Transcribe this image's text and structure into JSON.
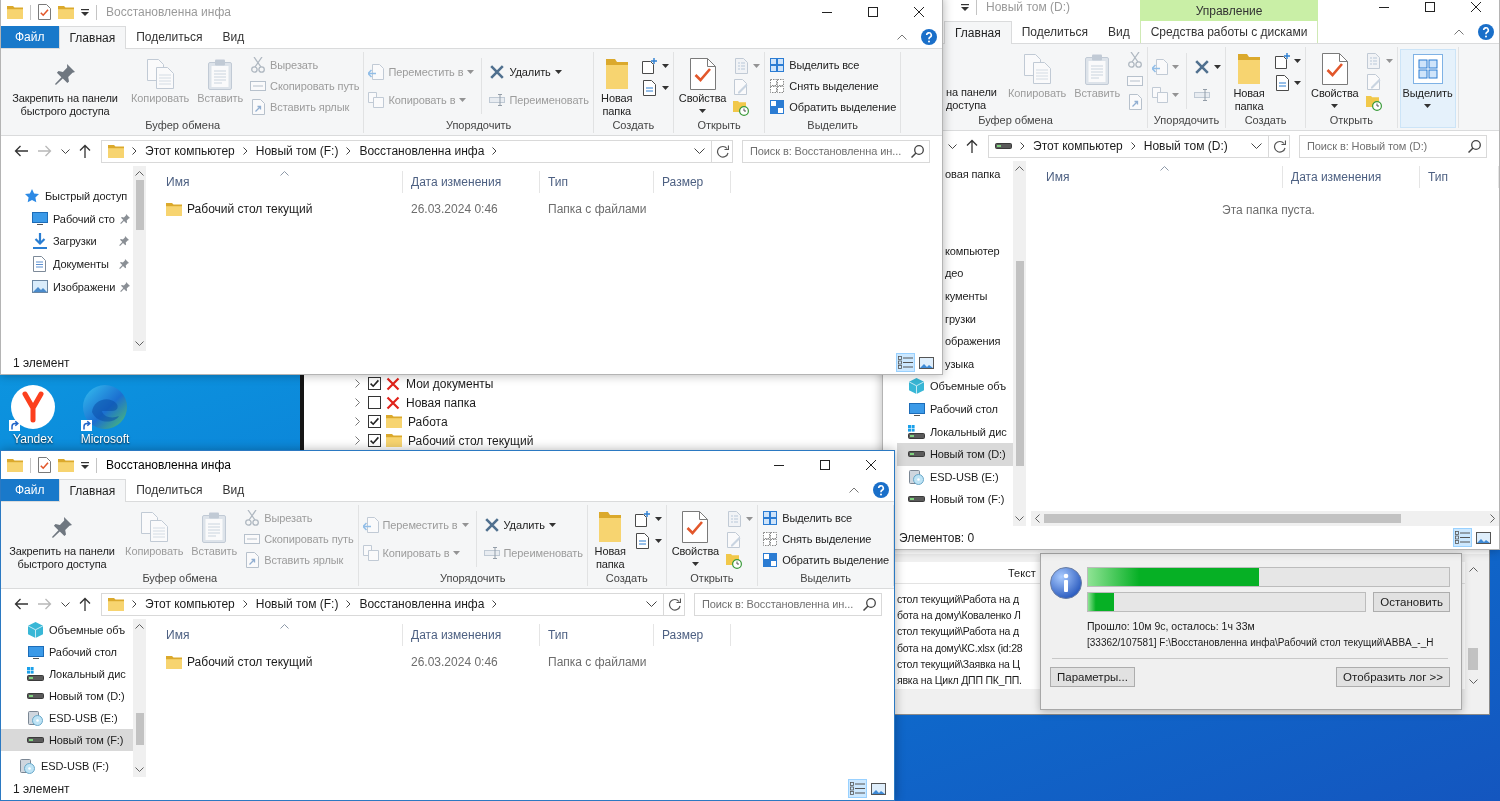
{
  "top_window": {
    "title": "Восстановленна инфа",
    "active": false,
    "tabs": [
      {
        "label": "Файл",
        "kind": "file",
        "selected": false
      },
      {
        "label": "Главная",
        "kind": "tab",
        "selected": true
      },
      {
        "label": "Поделиться",
        "kind": "tab",
        "selected": false
      },
      {
        "label": "Вид",
        "kind": "tab",
        "selected": false
      }
    ],
    "ribbon": [
      {
        "label": "Буфер обмена",
        "columns": [
          {
            "kind": "large",
            "items": [
              {
                "kind": "pin",
                "label": "Закрепить на панели быстрого доступа",
                "disabled": false,
                "menu": false
              },
              {
                "kind": "copy",
                "label": "Копировать",
                "disabled": true,
                "menu": false
              },
              {
                "kind": "paste",
                "label": "Вставить",
                "disabled": true,
                "menu": false
              }
            ]
          },
          {
            "kind": "small",
            "items": [
              {
                "kind": "cut",
                "label": "Вырезать",
                "disabled": true,
                "menu": false
              },
              {
                "kind": "copy-path",
                "label": "Скопировать путь",
                "disabled": true,
                "menu": false
              },
              {
                "kind": "paste-shortcut",
                "label": "Вставить ярлык",
                "disabled": true,
                "menu": false
              }
            ]
          }
        ]
      },
      {
        "label": "Упорядочить",
        "columns": [
          {
            "kind": "small",
            "items": [
              {
                "kind": "move-to",
                "label": "Переместить в",
                "disabled": true,
                "menu": true
              },
              {
                "kind": "copy-to",
                "label": "Копировать в",
                "disabled": true,
                "menu": true
              }
            ]
          },
          {
            "kind": "small",
            "items": [
              {
                "kind": "delete",
                "label": "Удалить",
                "disabled": false,
                "menu": true
              },
              {
                "kind": "rename",
                "label": "Переименовать",
                "disabled": true,
                "menu": false
              }
            ]
          }
        ]
      },
      {
        "label": "Создать",
        "columns": [
          {
            "kind": "large",
            "items": [
              {
                "kind": "new-folder",
                "label": "Новая папка",
                "disabled": false,
                "menu": false
              }
            ]
          },
          {
            "kind": "icons",
            "items": [
              {
                "kind": "new-item",
                "disabled": false,
                "menu": true
              },
              {
                "kind": "easy-access",
                "disabled": false,
                "menu": true
              }
            ]
          }
        ]
      },
      {
        "label": "Открыть",
        "columns": [
          {
            "kind": "large",
            "items": [
              {
                "kind": "properties",
                "label": "Свойства",
                "disabled": false,
                "menu": true
              }
            ]
          },
          {
            "kind": "icons",
            "items": [
              {
                "kind": "open",
                "disabled": true,
                "menu": true
              },
              {
                "kind": "edit",
                "disabled": true,
                "menu": false
              },
              {
                "kind": "history",
                "disabled": false,
                "menu": false
              }
            ]
          }
        ]
      },
      {
        "label": "Выделить",
        "columns": [
          {
            "kind": "small",
            "items": [
              {
                "kind": "select-all",
                "label": "Выделить все",
                "disabled": false,
                "menu": false
              },
              {
                "kind": "select-none",
                "label": "Снять выделение",
                "disabled": false,
                "menu": false
              },
              {
                "kind": "invert-selection",
                "label": "Обратить выделение",
                "disabled": false,
                "menu": false
              }
            ]
          }
        ]
      }
    ],
    "address": {
      "kind": "folder",
      "path": [
        "Этот компьютер",
        "Новый том (F:)",
        "Восстановленна инфа"
      ],
      "expandable": true
    },
    "search_placeholder": "Поиск в: Восстановленна ин...",
    "nav": [
      {
        "label": "Быстрый доступ",
        "kind": "star",
        "selected": false,
        "pinned": false,
        "children": [
          {
            "label": "Рабочий сто",
            "kind": "desktop",
            "selected": false,
            "pinned": true
          },
          {
            "label": "Загрузки",
            "kind": "downloads",
            "selected": false,
            "pinned": true
          },
          {
            "label": "Документы",
            "kind": "documents",
            "selected": false,
            "pinned": true
          },
          {
            "label": "Изображени",
            "kind": "pictures",
            "selected": false,
            "pinned": true
          }
        ]
      }
    ],
    "columns": [
      "Имя",
      "Дата изменения",
      "Тип",
      "Размер"
    ],
    "files": [
      {
        "name": "Рабочий стол текущий",
        "date": "26.03.2024 0:46",
        "type": "Папка с файлами",
        "selected": false
      }
    ],
    "status": "1 элемент",
    "views": [
      {
        "kind": "details",
        "selected": true
      },
      {
        "kind": "tiles",
        "selected": false
      }
    ]
  },
  "drive_window": {
    "title": "Новый том (D:)",
    "active": false,
    "context_header": "Управление",
    "tabs": [
      {
        "label": "Главная",
        "kind": "tab",
        "selected": true
      },
      {
        "label": "Поделиться",
        "kind": "tab",
        "selected": false
      },
      {
        "label": "Вид",
        "kind": "tab",
        "selected": false
      },
      {
        "label": "Средства работы с дисками",
        "kind": "context",
        "selected": false
      }
    ],
    "ribbon": [
      {
        "label": "Буфер обмена",
        "columns": [
          {
            "kind": "large",
            "items": [
              {
                "kind": "pin-cut",
                "label": "на панели доступа",
                "disabled": false,
                "menu": false
              },
              {
                "kind": "copy",
                "label": "Копировать",
                "disabled": true,
                "menu": false
              },
              {
                "kind": "paste",
                "label": "Вставить",
                "disabled": true,
                "menu": false
              }
            ]
          },
          {
            "kind": "small",
            "items": [
              {
                "kind": "cut",
                "disabled": true,
                "menu": false
              },
              {
                "kind": "copy-path",
                "disabled": true,
                "menu": false
              },
              {
                "kind": "paste-shortcut",
                "disabled": true,
                "menu": false
              }
            ]
          }
        ]
      },
      {
        "label": "Упорядочить",
        "columns": [
          {
            "kind": "small",
            "items": [
              {
                "kind": "move-to",
                "disabled": true,
                "menu": true
              },
              {
                "kind": "copy-to",
                "disabled": true,
                "menu": true
              }
            ]
          },
          {
            "kind": "small",
            "items": [
              {
                "kind": "delete",
                "disabled": false,
                "menu": true
              },
              {
                "kind": "rename",
                "disabled": true,
                "menu": false
              }
            ]
          }
        ]
      },
      {
        "label": "Создать",
        "columns": [
          {
            "kind": "large",
            "items": [
              {
                "kind": "new-folder",
                "label": "Новая папка",
                "disabled": false,
                "menu": false
              }
            ]
          },
          {
            "kind": "icons",
            "items": [
              {
                "kind": "new-item",
                "disabled": false,
                "menu": true
              },
              {
                "kind": "easy-access",
                "disabled": false,
                "menu": true
              }
            ]
          }
        ]
      },
      {
        "label": "Открыть",
        "columns": [
          {
            "kind": "large",
            "items": [
              {
                "kind": "properties",
                "label": "Свойства",
                "disabled": false,
                "menu": true
              }
            ]
          },
          {
            "kind": "icons",
            "items": [
              {
                "kind": "open",
                "disabled": true,
                "menu": true
              },
              {
                "kind": "edit",
                "disabled": true,
                "menu": false
              },
              {
                "kind": "history",
                "disabled": false,
                "menu": false
              }
            ]
          }
        ]
      },
      {
        "columns": [
          {
            "kind": "large",
            "items": [
              {
                "kind": "select",
                "label": "Выделить",
                "disabled": false,
                "menu": true,
                "highlighted": true
              }
            ]
          }
        ]
      }
    ],
    "address": {
      "kind": "drive",
      "path": [
        "Этот компьютер",
        "Новый том (D:)"
      ],
      "expandable": false
    },
    "search_placeholder": "Поиск в: Новый том (D:)",
    "nav": [
      {
        "children": [
          {
            "label": "овая папка",
            "kind": "partial",
            "selected": false
          }
        ]
      },
      {
        "label": "компьютер",
        "kind": "partial",
        "selected": false,
        "children": [
          {
            "label": "део",
            "kind": "partial",
            "selected": false
          },
          {
            "label": "кументы",
            "kind": "partial",
            "selected": false
          },
          {
            "label": "грузки",
            "kind": "partial",
            "selected": false
          },
          {
            "label": "ображения",
            "kind": "partial",
            "selected": false
          },
          {
            "label": "узыка",
            "kind": "partial",
            "selected": false
          },
          {
            "label": "Объемные объ",
            "kind": "objects3d",
            "selected": false
          },
          {
            "label": "Рабочий стол",
            "kind": "desktop",
            "selected": false
          },
          {
            "label": "Локальный дис",
            "kind": "local-disk",
            "selected": false
          },
          {
            "label": "Новый том (D:)",
            "kind": "drive",
            "selected": true
          },
          {
            "label": "ESD-USB (E:)",
            "kind": "usb",
            "selected": false
          },
          {
            "label": "Новый том (F:)",
            "kind": "drive",
            "selected": false
          }
        ]
      }
    ],
    "columns": [
      "Имя",
      "Дата изменения",
      "Тип"
    ],
    "empty_message": "Эта папка пуста.",
    "status": "Элементов: 0",
    "views": [
      {
        "kind": "details",
        "selected": true
      },
      {
        "kind": "tiles",
        "selected": false
      }
    ]
  },
  "desktop_icons": [
    {
      "label": "Yandex",
      "kind": "yandex"
    },
    {
      "label": "Microsoft",
      "kind": "edge"
    }
  ],
  "recovery_window": {
    "tree": [
      {
        "label": "Мои документы",
        "kind": "missing",
        "checked": true
      },
      {
        "label": "Новая папка",
        "kind": "missing",
        "checked": false
      },
      {
        "label": "Работа",
        "kind": "folder",
        "checked": true
      },
      {
        "label": "Рабочий стол текущий",
        "kind": "folder",
        "checked": true
      }
    ],
    "log_column": "Текст",
    "log_lines": [
      "стол текущий\\Работа на д",
      "бота на дому\\Коваленко Л",
      "стол текущий\\Работа на д",
      "бота на дому\\КС.xlsx (id:28",
      "стол текущий\\Заявка на Ц",
      "явка на Цикл ДПП ПК_ПП."
    ]
  },
  "bottom_window": {
    "title": "Восстановленна инфа",
    "active": true,
    "tabs": [
      {
        "label": "Файл",
        "kind": "file",
        "selected": false
      },
      {
        "label": "Главная",
        "kind": "tab",
        "selected": true
      },
      {
        "label": "Поделиться",
        "kind": "tab",
        "selected": false
      },
      {
        "label": "Вид",
        "kind": "tab",
        "selected": false
      }
    ],
    "ribbon": [
      {
        "label": "Буфер обмена",
        "columns": [
          {
            "kind": "large",
            "items": [
              {
                "kind": "pin",
                "label": "Закрепить на панели быстрого доступа",
                "disabled": false,
                "menu": false
              },
              {
                "kind": "copy",
                "label": "Копировать",
                "disabled": true,
                "menu": false
              },
              {
                "kind": "paste",
                "label": "Вставить",
                "disabled": true,
                "menu": false
              }
            ]
          },
          {
            "kind": "small",
            "items": [
              {
                "kind": "cut",
                "label": "Вырезать",
                "disabled": true,
                "menu": false
              },
              {
                "kind": "copy-path",
                "label": "Скопировать путь",
                "disabled": true,
                "menu": false
              },
              {
                "kind": "paste-shortcut",
                "label": "Вставить ярлык",
                "disabled": true,
                "menu": false
              }
            ]
          }
        ]
      },
      {
        "label": "Упорядочить",
        "columns": [
          {
            "kind": "small",
            "items": [
              {
                "kind": "move-to",
                "label": "Переместить в",
                "disabled": true,
                "menu": true
              },
              {
                "kind": "copy-to",
                "label": "Копировать в",
                "disabled": true,
                "menu": true
              }
            ]
          },
          {
            "kind": "small",
            "items": [
              {
                "kind": "delete",
                "label": "Удалить",
                "disabled": false,
                "menu": true
              },
              {
                "kind": "rename",
                "label": "Переименовать",
                "disabled": true,
                "menu": false
              }
            ]
          }
        ]
      },
      {
        "label": "Создать",
        "columns": [
          {
            "kind": "large",
            "items": [
              {
                "kind": "new-folder",
                "label": "Новая папка",
                "disabled": false,
                "menu": false
              }
            ]
          },
          {
            "kind": "icons",
            "items": [
              {
                "kind": "new-item",
                "disabled": false,
                "menu": true
              },
              {
                "kind": "easy-access",
                "disabled": false,
                "menu": true
              }
            ]
          }
        ]
      },
      {
        "label": "Открыть",
        "columns": [
          {
            "kind": "large",
            "items": [
              {
                "kind": "properties",
                "label": "Свойства",
                "disabled": false,
                "menu": true
              }
            ]
          },
          {
            "kind": "icons",
            "items": [
              {
                "kind": "open",
                "disabled": true,
                "menu": true
              },
              {
                "kind": "edit",
                "disabled": true,
                "menu": false
              },
              {
                "kind": "history",
                "disabled": false,
                "menu": false
              }
            ]
          }
        ]
      },
      {
        "label": "Выделить",
        "columns": [
          {
            "kind": "small",
            "items": [
              {
                "kind": "select-all",
                "label": "Выделить все",
                "disabled": false,
                "menu": false
              },
              {
                "kind": "select-none",
                "label": "Снять выделение",
                "disabled": false,
                "menu": false
              },
              {
                "kind": "invert-selection",
                "label": "Обратить выделение",
                "disabled": false,
                "menu": false
              }
            ]
          }
        ]
      }
    ],
    "address": {
      "kind": "folder",
      "path": [
        "Этот компьютер",
        "Новый том (F:)",
        "Восстановленна инфа"
      ],
      "expandable": true
    },
    "search_placeholder": "Поиск в: Восстановленна ин...",
    "nav": [
      {
        "children": [
          {
            "label": "Объемные объ",
            "kind": "objects3d",
            "selected": false
          },
          {
            "label": "Рабочий стол",
            "kind": "desktop",
            "selected": false
          },
          {
            "label": "Локальный дис",
            "kind": "local-disk",
            "selected": false
          },
          {
            "label": "Новый том (D:)",
            "kind": "drive",
            "selected": false
          },
          {
            "label": "ESD-USB (E:)",
            "kind": "usb",
            "selected": false
          },
          {
            "label": "Новый том (F:)",
            "kind": "drive",
            "selected": true
          }
        ]
      },
      {
        "label": "ESD-USB (F:)",
        "kind": "usb",
        "selected": false
      }
    ],
    "columns": [
      "Имя",
      "Дата изменения",
      "Тип",
      "Размер"
    ],
    "files": [
      {
        "name": "Рабочий стол текущий",
        "date": "26.03.2024 0:46",
        "type": "Папка с файлами",
        "selected": false
      }
    ],
    "status": "1 элемент",
    "views": [
      {
        "kind": "details",
        "selected": true
      },
      {
        "kind": "tiles",
        "selected": false
      }
    ]
  },
  "progress_dialog": {
    "total_progress": {
      "level": 0.475
    },
    "file_progress": {
      "level": 0.094
    },
    "stop_button": "Остановить",
    "elapsed": "Прошло: 10м 9с, осталось: 1ч 33м",
    "current_file": "[33362/107581] F:\\Восстановленна инфа\\Рабочий стол текущий\\ABBA_-_H",
    "options_button": "Параметры...",
    "log_button": "Отобразить лог >>"
  }
}
